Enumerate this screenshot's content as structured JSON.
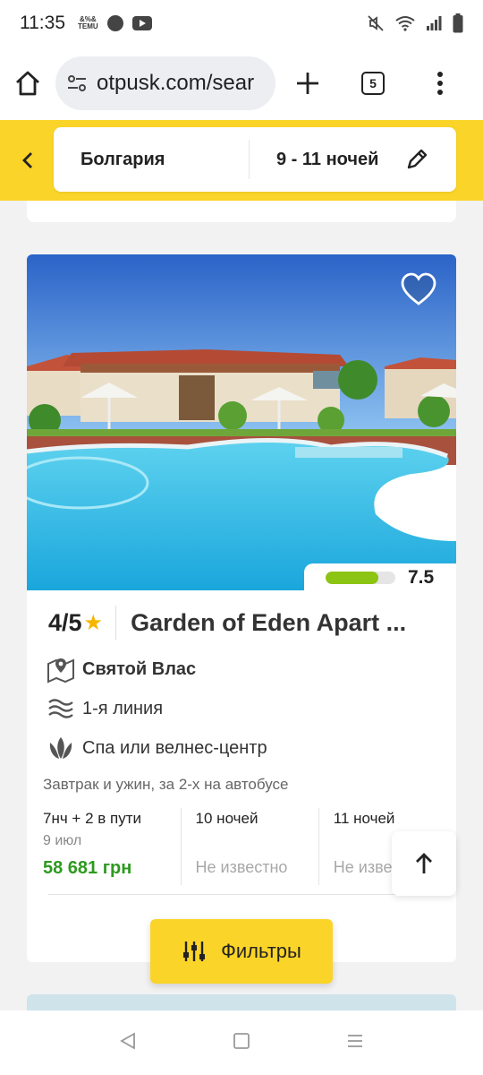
{
  "status_bar": {
    "time": "11:35",
    "temu_label": "TEMU",
    "icons": [
      "temu-icon",
      "dot-icon",
      "youtube-icon",
      "mute-icon",
      "wifi-icon",
      "signal-icon",
      "battery-icon"
    ]
  },
  "browser": {
    "url": "otpusk.com/sear",
    "tab_count": "5"
  },
  "search": {
    "destination": "Болгария",
    "nights": "9 - 11 ночей"
  },
  "hotel": {
    "rating_value": "7.5",
    "rating_fraction": 0.75,
    "stars": "4/5",
    "name": "Garden of Eden Apart ...",
    "location": "Святой Влас",
    "beach_line": "1-я линия",
    "spa": "Спа или велнес-центр",
    "meal_transport": "Завтрак и ужин, за 2-х на автобусе",
    "prices": [
      {
        "head": "7нч + 2 в пути",
        "sub": "9 июл",
        "price": "58 681 грн"
      },
      {
        "head": "10 ночей",
        "value": "Не известно"
      },
      {
        "head": "11 ночей",
        "value": "Не известно"
      }
    ]
  },
  "filters": {
    "label": "Фильтры"
  },
  "colors": {
    "accent_yellow": "#fbd429",
    "price_green": "#2d9a1f",
    "rating_green": "#8cc414"
  }
}
